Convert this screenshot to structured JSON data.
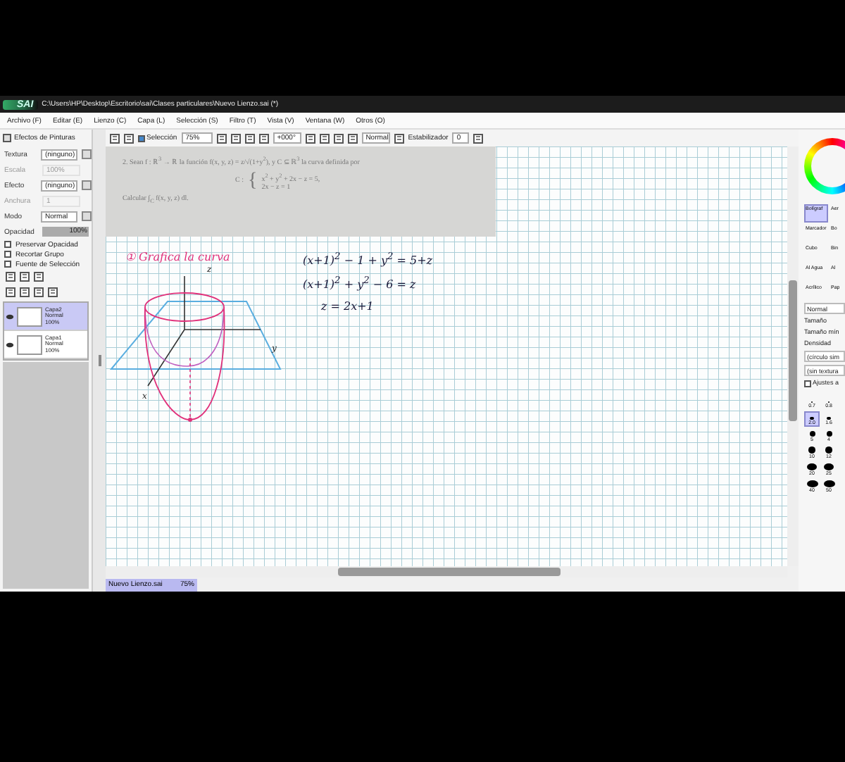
{
  "window": {
    "logo_text": "SAI",
    "path": "C:\\Users\\HP\\Desktop\\Escritorio\\sai\\Clases particulares\\Nuevo Lienzo.sai (*)"
  },
  "menu": [
    "Archivo (F)",
    "Editar (E)",
    "Lienzo (C)",
    "Capa (L)",
    "Selección (S)",
    "Filtro (T)",
    "Vista (V)",
    "Ventana (W)",
    "Otros (O)"
  ],
  "toolbar": {
    "selection_label": "Selección",
    "selection_checked": true,
    "zoom": "75%",
    "angle": "+000°",
    "blend": "Normal",
    "stabilizer_label": "Estabilizador",
    "stabilizer": "0"
  },
  "paint_effects": {
    "title": "Efectos de Pinturas",
    "rows": [
      {
        "label": "Textura",
        "value": "(ninguno)",
        "disabled": false
      },
      {
        "label": "Escala",
        "value": "100%",
        "disabled": true
      },
      {
        "label": "Efecto",
        "value": "(ninguno)",
        "disabled": false
      },
      {
        "label": "Anchura",
        "value": "1",
        "disabled": true
      }
    ]
  },
  "mode": {
    "label": "Modo",
    "value": "Normal"
  },
  "opacity": {
    "label": "Opacidad",
    "reading": "100%",
    "level": 1
  },
  "options": [
    {
      "label": "Preservar Opacidad",
      "checked": false
    },
    {
      "label": "Recortar Grupo",
      "checked": false
    },
    {
      "label": "Fuente de Selección",
      "checked": false
    }
  ],
  "layers": [
    {
      "name": "Capa2",
      "mode": "Normal",
      "opacity": "100%",
      "selected": true
    },
    {
      "name": "Capa1",
      "mode": "Normal",
      "opacity": "100%",
      "selected": false
    }
  ],
  "document": {
    "line1": "2. Sean f : ℝ$^{3}$ → ℝ la función f(x, y, z) = z/√(1+y$^{2}$), y C ⊆ ℝ$^{3}$ la curva definida por",
    "system_label": "C :",
    "brace": "{",
    "equations": [
      "x$^{2}$ + y$^{2}$ + 2x − z = 5,",
      "2x − z = 1"
    ],
    "line3": "Calcular ∫$_{C}$ f(x, y, z) dl."
  },
  "handwriting": [
    {
      "text": "① Grafica la curva",
      "color": "#e0307a"
    },
    {
      "text": "(x+1)$^{2}$ − 1 + y$^{2}$ = 5+z",
      "color": "#1a1a3a"
    },
    {
      "text": "(x+1)$^{2}$ + y$^{2}$ − 6 = z",
      "color": "#1a1a3a"
    },
    {
      "text": "z = 2x+1",
      "color": "#1a1a3a"
    }
  ],
  "sketch_labels": [
    "z",
    "y",
    "x"
  ],
  "tabs": [
    {
      "name": "Nuevo Lienzo.sai",
      "zoom": "75%",
      "selected": true
    }
  ],
  "tools": [
    {
      "name": "Bolígraf",
      "selected": true
    },
    {
      "name": "Aer",
      "selected": false
    },
    {
      "name": "Marcador",
      "selected": false
    },
    {
      "name": "Bo",
      "selected": false
    },
    {
      "name": "Cubo",
      "selected": false
    },
    {
      "name": "Bin",
      "selected": false
    },
    {
      "name": "Al Agua",
      "selected": false
    },
    {
      "name": "Al",
      "selected": false
    },
    {
      "name": "Acrílico",
      "selected": false
    },
    {
      "name": "Pap",
      "selected": false
    }
  ],
  "brush": {
    "blend": "Normal",
    "labels": [
      "Tamaño",
      "Tamaño mín",
      "Densidad"
    ],
    "shape": "(círculo sim",
    "texture": "(sin textura",
    "advanced": "Ajustes a",
    "advanced_checked": false
  },
  "sizes": [
    {
      "value": "0.7",
      "selected": false
    },
    {
      "value": "0.8",
      "selected": false
    },
    {
      "value": "2.0",
      "selected": true
    },
    {
      "value": "1.6",
      "selected": false
    },
    {
      "value": "5",
      "selected": false
    },
    {
      "value": "4",
      "selected": false
    },
    {
      "value": "10",
      "selected": false
    },
    {
      "value": "12",
      "selected": false
    },
    {
      "value": "20",
      "selected": false
    },
    {
      "value": "25",
      "selected": false
    },
    {
      "value": "40",
      "selected": false
    },
    {
      "value": "50",
      "selected": false
    }
  ]
}
